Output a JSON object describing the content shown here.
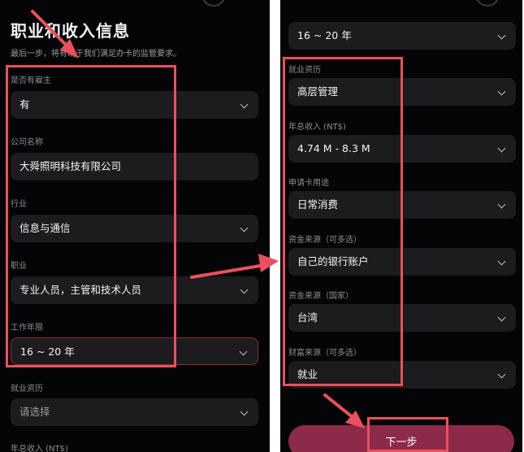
{
  "left_panel": {
    "title": "职业和收入信息",
    "subtitle": "最后一步，将有助于我们满足办卡的监管要求。",
    "fields": [
      {
        "label": "是否有雇主",
        "value": "有"
      },
      {
        "label": "公司名称",
        "value": "大舜照明科技有限公司"
      },
      {
        "label": "行业",
        "value": "信息与通信"
      },
      {
        "label": "职业",
        "value": "专业人员，主管和技术人员"
      },
      {
        "label": "工作年限",
        "value": "16 ~ 20 年"
      },
      {
        "label": "就业资历",
        "placeholder": "请选择"
      },
      {
        "label": "年总收入 (NT$)"
      }
    ]
  },
  "right_panel": {
    "top_value": "16 ~ 20 年",
    "fields": [
      {
        "label": "就业资历",
        "value": "高层管理"
      },
      {
        "label": "年总收入 (NT$)",
        "value": "4.74 M - 8.3 M"
      },
      {
        "label": "申请卡用途",
        "value": "日常消费"
      },
      {
        "label": "资金来源（可多选）",
        "value": "自己的银行账户"
      },
      {
        "label": "资金来源（国家）",
        "value": "台湾"
      },
      {
        "label": "财富来源（可多选）",
        "value": "就业"
      }
    ],
    "next_button": "下一步"
  },
  "colors": {
    "background": "#050507",
    "field": "#1c1c1f",
    "annotation": "#ec4f5d",
    "button": "#8c2a4a"
  }
}
